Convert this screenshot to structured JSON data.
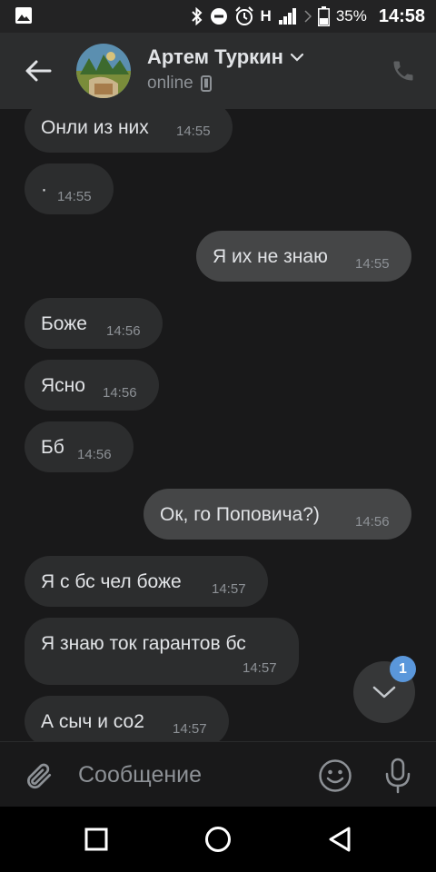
{
  "status_bar": {
    "carrier_letter": "H",
    "battery": "35%",
    "time": "14:58"
  },
  "header": {
    "contact_name": "Артем Туркин",
    "status": "online"
  },
  "messages": [
    {
      "text": "Онли из них",
      "time": "14:55",
      "direction": "in"
    },
    {
      "text": "·",
      "time": "14:55",
      "direction": "in"
    },
    {
      "text": "Я их не знаю",
      "time": "14:55",
      "direction": "out"
    },
    {
      "text": "Боже",
      "time": "14:56",
      "direction": "in"
    },
    {
      "text": "Ясно",
      "time": "14:56",
      "direction": "in"
    },
    {
      "text": "Бб",
      "time": "14:56",
      "direction": "in"
    },
    {
      "text": "Ок, го Поповича?)",
      "time": "14:56",
      "direction": "out"
    },
    {
      "text": "Я с бс чел боже",
      "time": "14:57",
      "direction": "in"
    },
    {
      "text": "Я знаю ток гарантов бс",
      "time": "14:57",
      "direction": "in"
    },
    {
      "text": "А сыч и со2",
      "time": "14:57",
      "direction": "in"
    }
  ],
  "unread_count": "1",
  "composer": {
    "placeholder": "Сообщение"
  },
  "colors": {
    "background": "#19191a",
    "header": "#2c2d2e",
    "bubble_in": "#2c2d2e",
    "bubble_out": "#454647",
    "badge": "#5a97db"
  },
  "icons": {
    "gallery": "image-icon",
    "bluetooth": "bluetooth-icon",
    "dnd": "do-not-disturb-icon",
    "alarm": "alarm-icon",
    "signal": "signal-icon",
    "battery": "battery-icon",
    "back": "arrow-left-icon",
    "phone": "phone-icon",
    "mobile": "mobile-device-icon",
    "attach": "paperclip-icon",
    "emoji": "smiley-icon",
    "mic": "microphone-icon",
    "scroll": "chevron-down-icon"
  }
}
